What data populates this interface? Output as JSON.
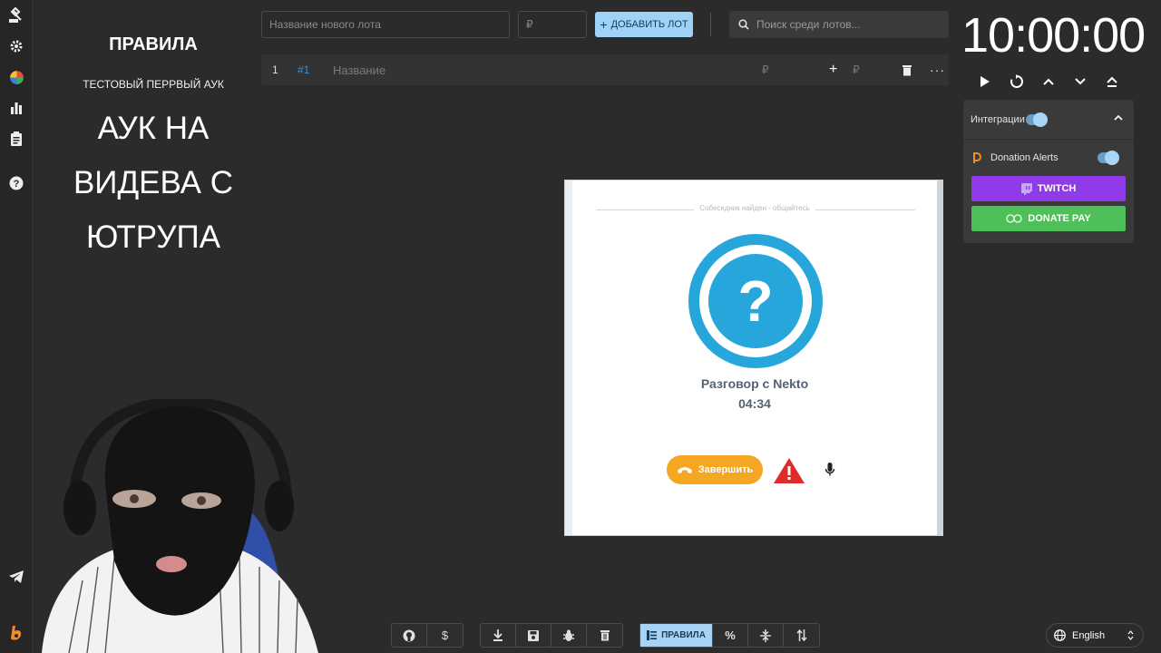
{
  "rules_panel": {
    "title": "ПРАВИЛА",
    "subtitle": "ТЕСТОВЫЙ ПЕРРВЫЙ АУК",
    "headline_lines": [
      "АУК НА",
      "ВИДЕВА С",
      "ЮТРУПА"
    ]
  },
  "toolbar": {
    "new_lot_placeholder": "Название нового лота",
    "amount_placeholder": "₽",
    "add_lot_label": "ДОБАВИТЬ ЛОТ",
    "search_placeholder": "Поиск среди лотов..."
  },
  "lot_row": {
    "index": "1",
    "id": "#1",
    "name_placeholder": "Название",
    "currency_1": "₽",
    "currency_2": "₽"
  },
  "timer": {
    "value": "10:00:00"
  },
  "integrations": {
    "label": "Интеграции",
    "enabled": true,
    "donation_alerts_label": "Donation Alerts",
    "donation_alerts_enabled": true,
    "twitch_label": "TWITCH",
    "donatepay_label": "DONATE PAY"
  },
  "video_call": {
    "status_text": "Собеседник найден - общайтесь",
    "conversation_label": "Разговор с Nekto",
    "duration": "04:34",
    "end_button_label": "Завершить"
  },
  "bottom_bar": {
    "rules_label": "ПРАВИЛА",
    "percent_label": "%"
  },
  "language": {
    "selected": "English"
  },
  "colors": {
    "accent_blue": "#a7d4f6",
    "twitch_purple": "#8f3be8",
    "donatepay_green": "#4fbf5a",
    "call_blue": "#27a6dc",
    "end_orange": "#f5a623",
    "warning_red": "#e02b2b"
  }
}
